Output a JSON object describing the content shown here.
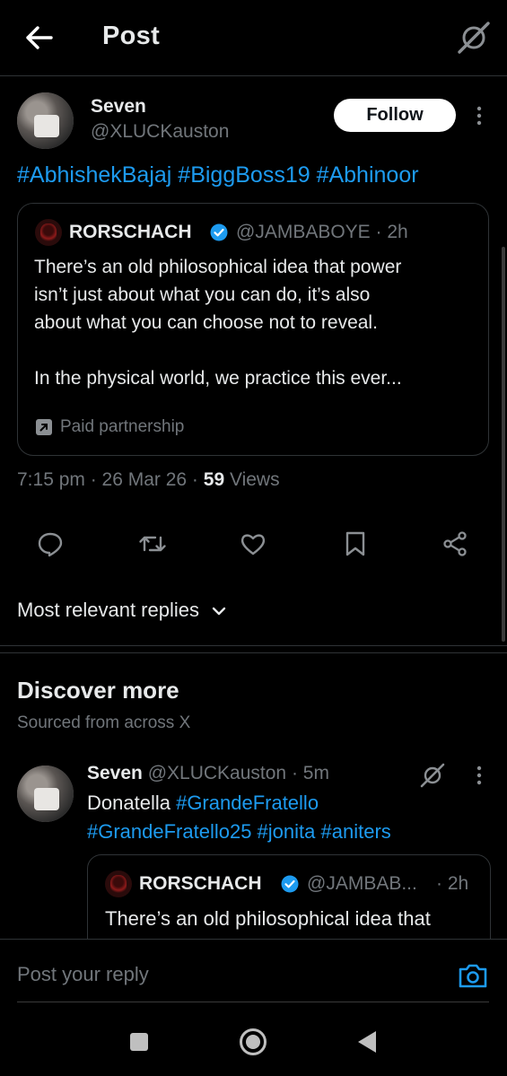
{
  "header": {
    "title": "Post",
    "back_icon": "back-arrow-icon",
    "grok_icon": "grok-icon"
  },
  "post": {
    "author_name": "Seven",
    "handle": "@XLUCKauston",
    "follow_label": "Follow",
    "hashtags": [
      "#AbhishekBajaj",
      "#BiggBoss19",
      "#Abhinoor"
    ],
    "quote": {
      "name": "RORSCHACH",
      "handle_time": "@JAMBABOYE · 2h",
      "lines": [
        "There’s an old philosophical idea that power",
        "isn’t just about what you can do, it’s also",
        "about what you can choose not to reveal.",
        "In the physical world, we practice this ever..."
      ],
      "paid_label": "Paid partnership"
    },
    "timestamp": "7:15 pm · 26 Mar 26 · ",
    "views_count": "59",
    "views_label": " Views"
  },
  "actions": [
    "reply-icon",
    "repost-icon",
    "like-icon",
    "bookmark-icon",
    "share-icon"
  ],
  "replies_sort": "Most relevant replies",
  "discover": {
    "title": "Discover more",
    "subtitle": "Sourced from across X",
    "item": {
      "name": "Seven",
      "handle_time": "@XLUCKauston · 5m",
      "text_plain": "Donatella ",
      "tags_line1": "#GrandeFratello",
      "tags_line2": "#GrandeFratello25 #jonita #aniters",
      "quote_name": "RORSCHACH",
      "quote_handle": "@JAMBAB...",
      "quote_time": "· 2h",
      "quote_text": "There’s an old philosophical idea that"
    }
  },
  "reply": {
    "placeholder": "Post your reply",
    "camera_icon": "camera-icon"
  },
  "colors": {
    "accent": "#1d9bf0",
    "muted": "#71767b",
    "background": "#000000",
    "border": "#2f3336"
  }
}
